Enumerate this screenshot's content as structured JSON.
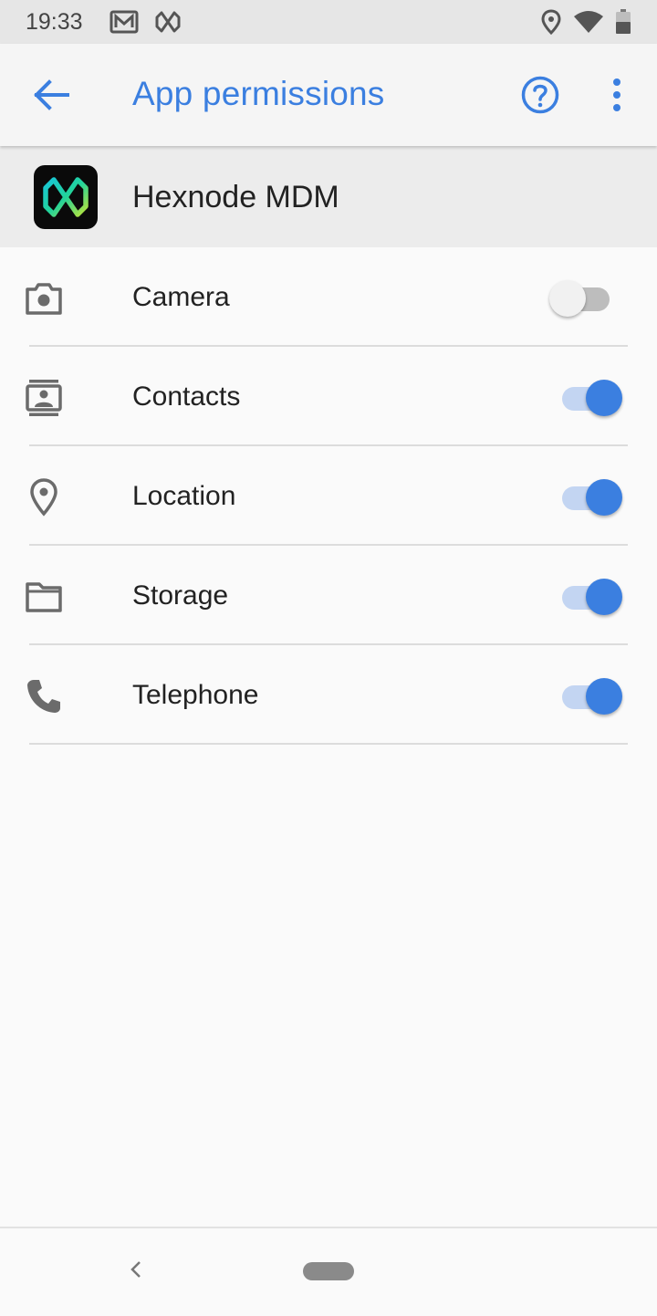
{
  "status_bar": {
    "time": "19:33",
    "left_icons": [
      "gmail-icon",
      "hexnode-notification-icon"
    ],
    "right_icons": [
      "location-icon",
      "wifi-icon",
      "battery-icon"
    ]
  },
  "app_bar": {
    "title": "App permissions",
    "back_icon": "arrow-back-icon",
    "help_icon": "help-circle-icon",
    "more_icon": "more-vert-icon"
  },
  "app": {
    "name": "Hexnode MDM",
    "icon": "hexnode-logo-icon"
  },
  "permissions": [
    {
      "label": "Camera",
      "icon": "camera-icon",
      "enabled": false
    },
    {
      "label": "Contacts",
      "icon": "contacts-icon",
      "enabled": true
    },
    {
      "label": "Location",
      "icon": "location-pin-icon",
      "enabled": true
    },
    {
      "label": "Storage",
      "icon": "folder-icon",
      "enabled": true
    },
    {
      "label": "Telephone",
      "icon": "phone-icon",
      "enabled": true
    }
  ],
  "colors": {
    "accent": "#3b7fe0",
    "status_bar_bg": "#e6e6e6",
    "app_header_bg": "#ececec",
    "background": "#fafafa"
  },
  "nav_bar": {
    "back_icon": "nav-back-icon",
    "home_icon": "nav-home-pill-icon"
  }
}
